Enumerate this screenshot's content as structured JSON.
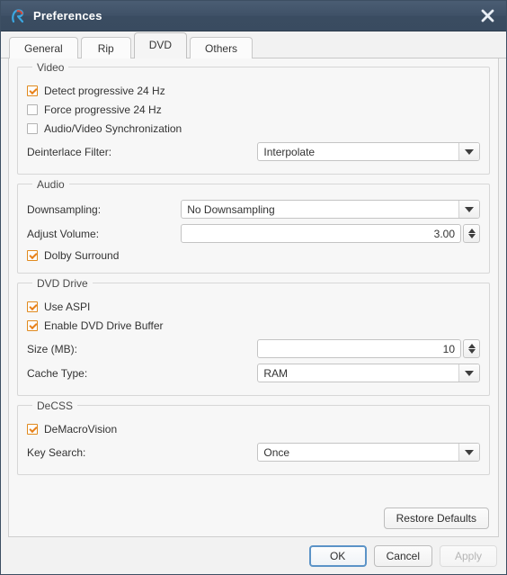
{
  "window": {
    "title": "Preferences",
    "app_icon": "r-logo-icon",
    "close_icon": "close-icon",
    "titlebar_color": "#3f5167",
    "accent_color": "#e8811a",
    "focus_color": "#5b93c7"
  },
  "tabs": [
    {
      "label": "General",
      "selected": false
    },
    {
      "label": "Rip",
      "selected": false
    },
    {
      "label": "DVD",
      "selected": true
    },
    {
      "label": "Others",
      "selected": false
    }
  ],
  "groups": {
    "video": {
      "title": "Video",
      "detect_progressive": {
        "label": "Detect progressive 24 Hz",
        "checked": true
      },
      "force_progressive": {
        "label": "Force progressive 24 Hz",
        "checked": false
      },
      "av_sync": {
        "label": "Audio/Video Synchronization",
        "checked": false
      },
      "deinterlace": {
        "label": "Deinterlace Filter:",
        "value": "Interpolate"
      }
    },
    "audio": {
      "title": "Audio",
      "downsampling": {
        "label": "Downsampling:",
        "value": "No Downsampling"
      },
      "adjust_volume": {
        "label": "Adjust Volume:",
        "value": "3.00"
      },
      "dolby_surround": {
        "label": "Dolby Surround",
        "checked": true
      }
    },
    "dvd_drive": {
      "title": "DVD Drive",
      "use_aspi": {
        "label": "Use ASPI",
        "checked": true
      },
      "enable_buffer": {
        "label": "Enable DVD Drive Buffer",
        "checked": true
      },
      "size_mb": {
        "label": "Size (MB):",
        "value": "10"
      },
      "cache_type": {
        "label": "Cache Type:",
        "value": "RAM"
      }
    },
    "decss": {
      "title": "DeCSS",
      "demacrovision": {
        "label": "DeMacroVision",
        "checked": true
      },
      "key_search": {
        "label": "Key Search:",
        "value": "Once"
      }
    }
  },
  "buttons": {
    "restore_defaults": "Restore Defaults",
    "ok": "OK",
    "cancel": "Cancel",
    "apply": "Apply"
  }
}
